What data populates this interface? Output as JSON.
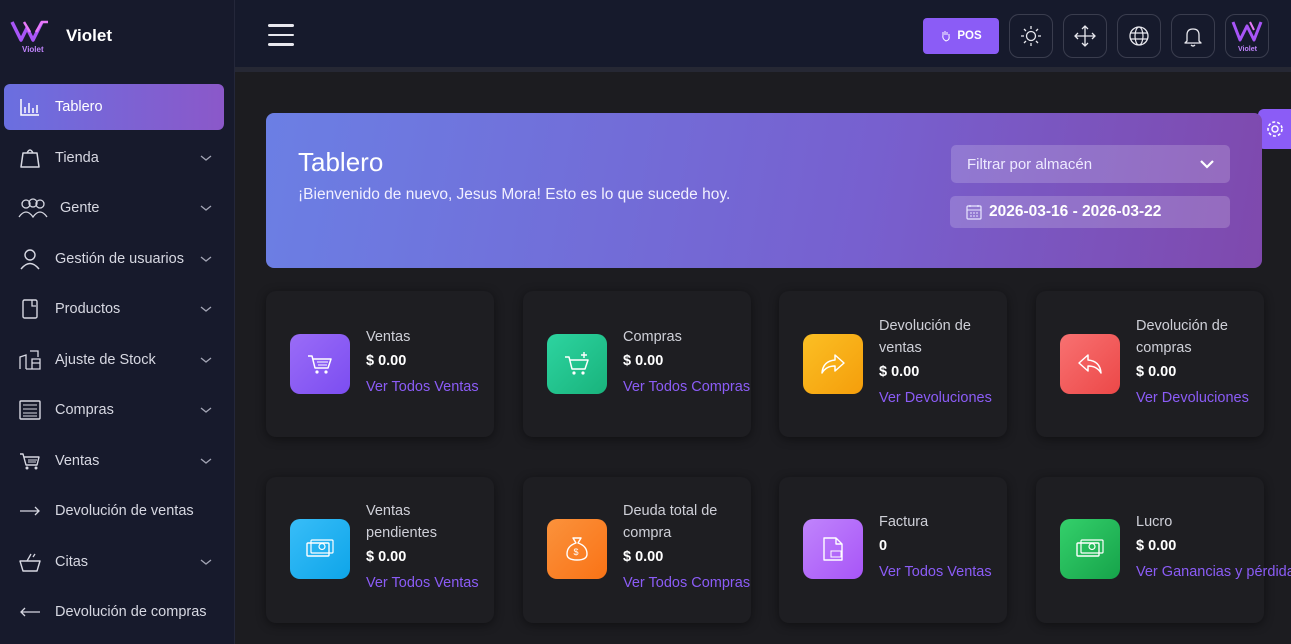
{
  "brand": {
    "name": "Violet",
    "logo_text": "Violet"
  },
  "sidebar": {
    "items": [
      {
        "label": "Tablero",
        "icon": "chart-icon",
        "active": true
      },
      {
        "label": "Tienda",
        "icon": "store-icon"
      },
      {
        "label": "Gente",
        "icon": "people-icon"
      },
      {
        "label": "Gestión de usuarios",
        "icon": "user-icon"
      },
      {
        "label": "Productos",
        "icon": "product-icon"
      },
      {
        "label": "Ajuste de Stock",
        "icon": "stock-icon"
      },
      {
        "label": "Compras",
        "icon": "purchases-icon"
      },
      {
        "label": "Ventas",
        "icon": "cart-icon"
      },
      {
        "label": "Devolución de ventas",
        "icon": "arrow-right-icon"
      },
      {
        "label": "Citas",
        "icon": "basket-icon"
      },
      {
        "label": "Devolución de compras",
        "icon": "arrow-left-icon"
      }
    ]
  },
  "header": {
    "pos_label": "POS",
    "icons": [
      "sun-icon",
      "fullscreen-icon",
      "globe-icon",
      "bell-icon"
    ]
  },
  "banner": {
    "title": "Tablero",
    "welcome": "¡Bienvenido de nuevo, Jesus Mora! Esto es lo que sucede hoy.",
    "filter_label": "Filtrar por almacén",
    "date_range": "2026-03-16 - 2026-03-22"
  },
  "cards": [
    {
      "title": "Ventas",
      "value": "$ 0.00",
      "link": "Ver Todos Ventas",
      "color": "#8b5cf6"
    },
    {
      "title": "Compras",
      "value": "$ 0.00",
      "link": "Ver Todos Compras",
      "color": "#22c38e"
    },
    {
      "title": "Devolución de ventas",
      "value": "$ 0.00",
      "link": "Ver Devoluciones",
      "color": "#f8ac16"
    },
    {
      "title": "Devolución de compras",
      "value": "$ 0.00",
      "link": "Ver Devoluciones",
      "color": "#ef5a5a"
    },
    {
      "title": "Ventas pendientes",
      "value": "$ 0.00",
      "link": "Ver Todos Ventas",
      "color": "#1da5e8"
    },
    {
      "title": "Deuda total de compra",
      "value": "$ 0.00",
      "link": "Ver Todos Compras",
      "color": "#fb8a34"
    },
    {
      "title": "Factura",
      "value": "0",
      "link": "Ver Todos Ventas",
      "color": "#b06df5"
    },
    {
      "title": "Lucro",
      "value": "$ 0.00",
      "link": "Ver Ganancias y pérdidas",
      "color": "#22b55a"
    }
  ]
}
